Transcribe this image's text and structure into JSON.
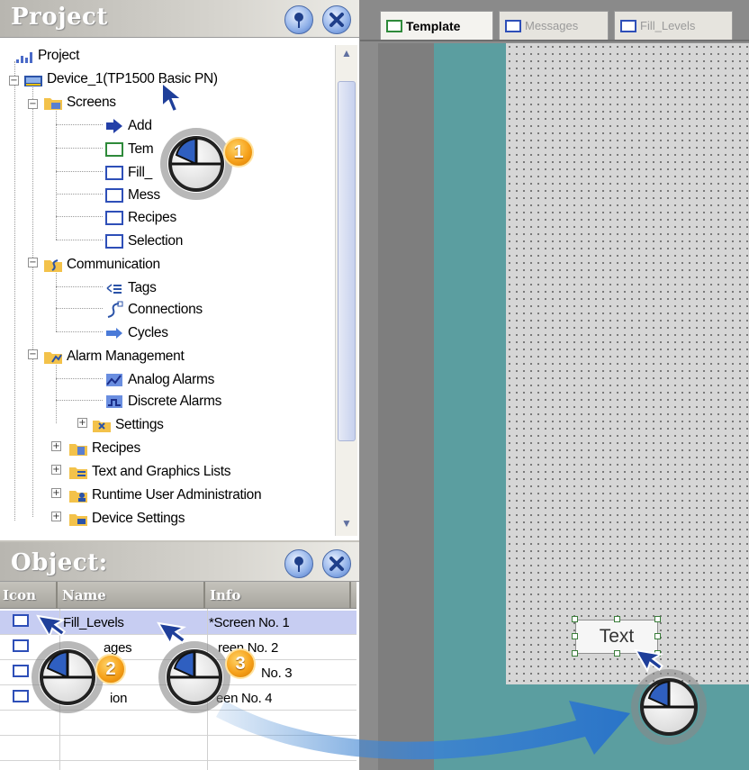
{
  "project_panel": {
    "title": "Project",
    "tree": [
      {
        "label": "Project",
        "icon": "project-icon"
      },
      {
        "label": "Device_1(TP1500 Basic PN)",
        "icon": "device-icon"
      },
      {
        "label": "Screens",
        "icon": "folder-screens-icon"
      },
      {
        "label": "Add",
        "icon": "add-screen-icon"
      },
      {
        "label": "Tem",
        "icon": "screen-template-icon"
      },
      {
        "label": "Fill_",
        "icon": "screen-icon"
      },
      {
        "label": "Mess",
        "icon": "screen-icon"
      },
      {
        "label": "Recipes",
        "icon": "screen-icon"
      },
      {
        "label": "Selection",
        "icon": "screen-icon"
      },
      {
        "label": "Communication",
        "icon": "folder-communication-icon"
      },
      {
        "label": "Tags",
        "icon": "tags-icon"
      },
      {
        "label": "Connections",
        "icon": "connections-icon"
      },
      {
        "label": "Cycles",
        "icon": "cycles-icon"
      },
      {
        "label": "Alarm Management",
        "icon": "folder-alarm-icon"
      },
      {
        "label": "Analog Alarms",
        "icon": "analog-alarms-icon"
      },
      {
        "label": "Discrete Alarms",
        "icon": "discrete-alarms-icon"
      },
      {
        "label": "Settings",
        "icon": "settings-icon"
      },
      {
        "label": "Recipes",
        "icon": "folder-recipes-icon"
      },
      {
        "label": "Text and Graphics Lists",
        "icon": "folder-lists-icon"
      },
      {
        "label": "Runtime User Administration",
        "icon": "folder-users-icon"
      },
      {
        "label": "Device Settings",
        "icon": "folder-device-settings-icon"
      }
    ]
  },
  "object_panel": {
    "title": "Object:",
    "columns": {
      "icon": "Icon",
      "name": "Name",
      "info": "Info"
    },
    "rows": [
      {
        "name": "Fill_Levels",
        "info": "*Screen No. 1"
      },
      {
        "name": "ages",
        "info": "reen No. 2"
      },
      {
        "name": "",
        "info": "No. 3"
      },
      {
        "name": "ion",
        "info": "een No. 4"
      }
    ]
  },
  "editor": {
    "tabs": [
      {
        "label": "Template",
        "active": true
      },
      {
        "label": "Messages",
        "active": false
      },
      {
        "label": "Fill_Levels",
        "active": false
      }
    ],
    "text_field_label": "Text"
  },
  "steps": [
    "1",
    "2",
    "3"
  ],
  "colors": {
    "screen_bg": "#5b9ea0",
    "selection": "#c7cdf2",
    "badge": "#f6a11a"
  }
}
